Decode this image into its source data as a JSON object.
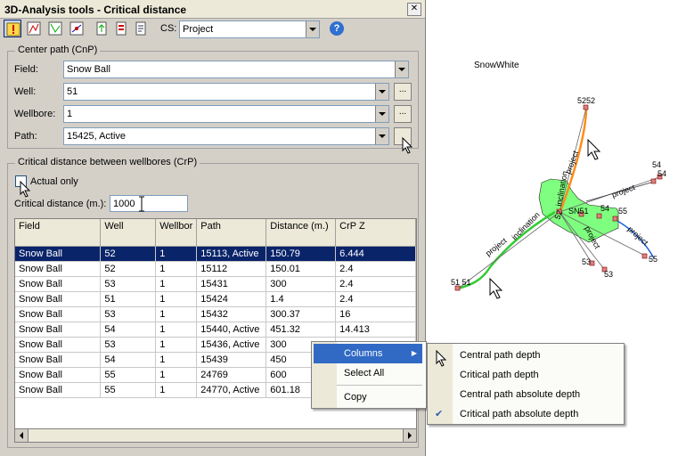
{
  "window": {
    "title": "3D-Analysis tools - Critical distance",
    "close_glyph": "✕"
  },
  "toolbar": {
    "cs_label": "CS:",
    "cs_value": "Project",
    "help_glyph": "?"
  },
  "center_path": {
    "legend": "Center path (CnP)",
    "field_label": "Field:",
    "field_value": "Snow Ball",
    "well_label": "Well:",
    "well_value": "51",
    "wellbore_label": "Wellbore:",
    "wellbore_value": "1",
    "path_label": "Path:",
    "path_value": "15425, Active",
    "ellipsis": "..."
  },
  "critical": {
    "legend": "Critical distance between wellbores (CrP)",
    "actual_only_label": "Actual only",
    "distance_label": "Critical distance (m.):",
    "distance_value": "1000"
  },
  "grid": {
    "columns": [
      "Field",
      "Well",
      "Wellbor",
      "Path",
      "Distance (m.)",
      "CrP Z"
    ],
    "rows": [
      [
        "Snow Ball",
        "52",
        "1",
        "15113, Active",
        "150.79",
        "6.444"
      ],
      [
        "Snow Ball",
        "52",
        "1",
        "15112",
        "150.01",
        "2.4"
      ],
      [
        "Snow Ball",
        "53",
        "1",
        "15431",
        "300",
        "2.4"
      ],
      [
        "Snow Ball",
        "51",
        "1",
        "15424",
        "1.4",
        "2.4"
      ],
      [
        "Snow Ball",
        "53",
        "1",
        "15432",
        "300.37",
        "16"
      ],
      [
        "Snow Ball",
        "54",
        "1",
        "15440, Active",
        "451.32",
        "14.413"
      ],
      [
        "Snow Ball",
        "53",
        "1",
        "15436, Active",
        "300",
        ""
      ],
      [
        "Snow Ball",
        "54",
        "1",
        "15439",
        "450",
        ""
      ],
      [
        "Snow Ball",
        "55",
        "1",
        "24769",
        "600",
        ""
      ],
      [
        "Snow Ball",
        "55",
        "1",
        "24770, Active",
        "601.18",
        ""
      ]
    ]
  },
  "context_menu": {
    "columns": "Columns",
    "select_all": "Select All",
    "copy": "Copy",
    "submenu_arrow": "▶"
  },
  "submenu": {
    "items": [
      "Central path depth",
      "Critical path depth",
      "Central path absolute depth",
      "Critical path absolute depth"
    ],
    "check_glyph": "✔"
  },
  "map": {
    "title": "SnowWhite",
    "labels": {
      "w52": "5252",
      "w51": "51 51",
      "w54": "54",
      "w54b": "54",
      "w55": "55",
      "w55b": "55",
      "w53": "53",
      "w53b": "53",
      "sn": "SN51",
      "n52": "52",
      "n54": "54",
      "project1": "project",
      "inclination1": "inclination",
      "project2": "project",
      "inclination2": "inclination",
      "project3": "project",
      "project4": "project",
      "project5": "project"
    },
    "colors": {
      "polygon": "#7fff7f",
      "green_path": "#33cc33",
      "orange_path": "#ff8c1a",
      "blue_path": "#1f5fd6"
    }
  }
}
